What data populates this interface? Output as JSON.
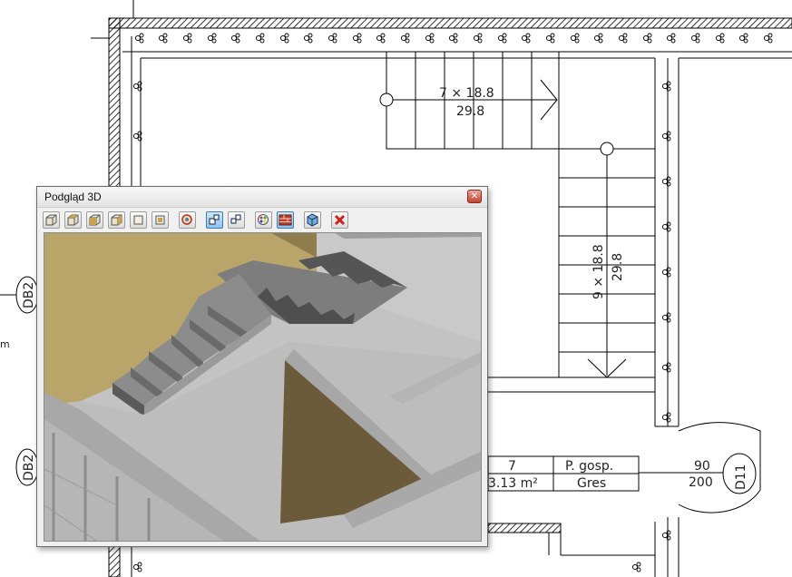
{
  "window": {
    "title": "Podgląd 3D",
    "close_symbol": "✕"
  },
  "toolbar": {
    "buttons": [
      {
        "icon": "box-view-front-icon"
      },
      {
        "icon": "box-view-top-icon"
      },
      {
        "icon": "box-view-left-icon"
      },
      {
        "icon": "box-view-right-icon"
      },
      {
        "icon": "box-view-back-icon"
      },
      {
        "icon": "box-view-iso-icon"
      },
      {
        "icon": "zoom-extents-icon"
      },
      {
        "icon": "zoom-in-icon",
        "active": true
      },
      {
        "icon": "zoom-out-icon"
      },
      {
        "icon": "render-colors-icon"
      },
      {
        "icon": "wall-texture-icon",
        "active": true
      },
      {
        "icon": "export-3d-icon"
      },
      {
        "icon": "close-view-icon"
      }
    ]
  },
  "drawing": {
    "stair_top": {
      "steps_label": "7 × 18.8",
      "depth_label": "29.8"
    },
    "stair_right": {
      "steps_label": "9 × 18.8",
      "depth_label": "29.8"
    },
    "room": {
      "number": "7",
      "area": "3.13 m²",
      "name": "P. gosp.",
      "floor": "Gres"
    },
    "door": {
      "width": "90",
      "height": "200",
      "tag": "D11"
    },
    "window_tag_top": "DB2",
    "window_tag_bottom": "DB2",
    "edge_text": "m"
  },
  "colors": {
    "wall_hatch": "#000000",
    "view_bg": "#c5c5c5",
    "floor_tan": "#b9a46a",
    "floor_dark": "#6b5b3a",
    "stair_grey": "#8a8a8a"
  }
}
